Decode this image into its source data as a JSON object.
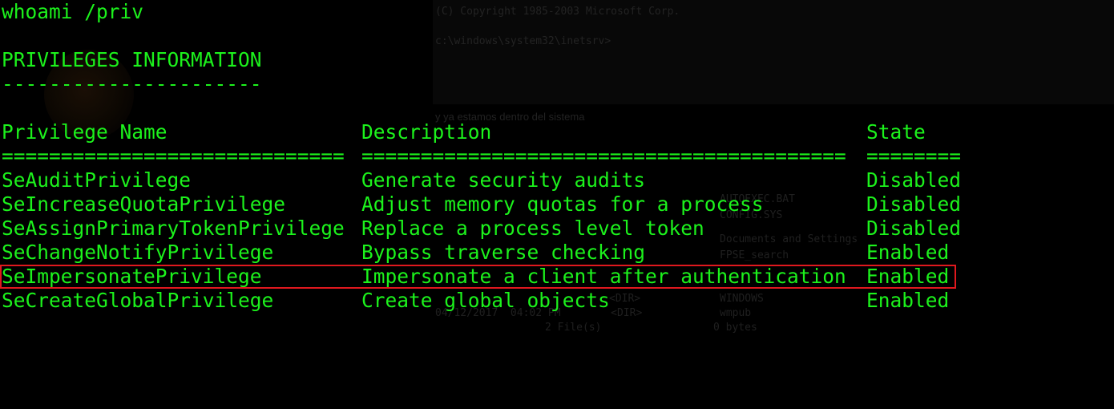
{
  "terminal": {
    "command": "whoami /priv",
    "section_title": "PRIVILEGES INFORMATION",
    "section_underline": "----------------------",
    "headers": {
      "name": "Privilege Name",
      "description": "Description",
      "state": "State"
    },
    "separators": {
      "name": "=============================",
      "description": "=========================================",
      "state": "========"
    },
    "rows": [
      {
        "name": "SeAuditPrivilege",
        "description": "Generate security audits",
        "state": "Disabled"
      },
      {
        "name": "SeIncreaseQuotaPrivilege",
        "description": "Adjust memory quotas for a process",
        "state": "Disabled"
      },
      {
        "name": "SeAssignPrimaryTokenPrivilege",
        "description": "Replace a process level token",
        "state": "Disabled"
      },
      {
        "name": "SeChangeNotifyPrivilege",
        "description": "Bypass traverse checking",
        "state": "Enabled"
      },
      {
        "name": "SeImpersonatePrivilege",
        "description": "Impersonate a client after authentication",
        "state": "Enabled"
      },
      {
        "name": "SeCreateGlobalPrivilege",
        "description": "Create global objects",
        "state": "Enabled"
      }
    ],
    "highlighted_row": 4
  },
  "background_ghost": {
    "copyright": "(C) Copyright 1985-2003 Microsoft Corp.",
    "prompt": "c:\\windows\\system32\\inetsrv>",
    "caption": "y ya estamos dentro del sistema",
    "listing": [
      "AUTOEXEC.BAT",
      "CONFIG.SYS",
      "Documents and Settings",
      "FPSE_search",
      "WINDOWS",
      "wmpub"
    ],
    "listing_meta": [
      "<DIR>",
      "04/12/2017  04:02 PM        <DIR>",
      "2 File(s)",
      "0 bytes"
    ]
  },
  "colors": {
    "text": "#1cf21c",
    "background": "#000000",
    "highlight_border": "#e0181e"
  }
}
